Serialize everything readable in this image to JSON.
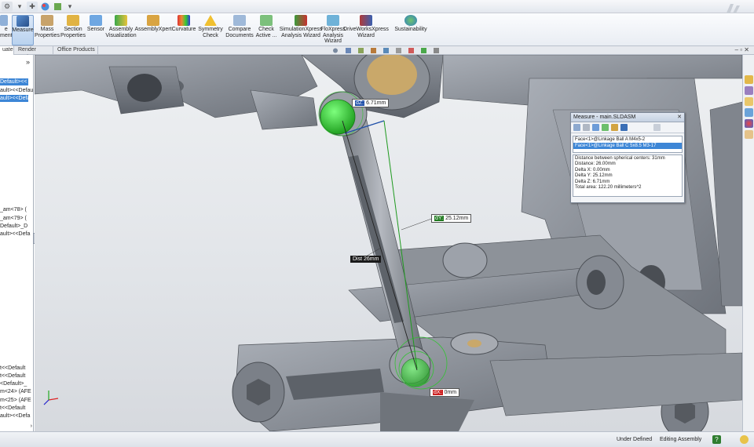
{
  "ribbon": {
    "buttons": [
      {
        "label": "Measure",
        "active": true
      },
      {
        "label": "Mass Properties"
      },
      {
        "label": "Section Properties"
      },
      {
        "label": "Sensor"
      },
      {
        "label": "Assembly Visualization"
      },
      {
        "label": "AssemblyXpert"
      },
      {
        "label": "Curvature"
      },
      {
        "label": "Symmetry Check"
      },
      {
        "label": "Compare Documents"
      },
      {
        "label": "Check Active ..."
      },
      {
        "label": "SimulationXpress Analysis Wizard"
      },
      {
        "label": "FloXpress Analysis Wizard"
      },
      {
        "label": "DriveWorksXpress Wizard"
      },
      {
        "label": "Sustainability"
      }
    ],
    "left_cut_label": "e\nment"
  },
  "tabs": [
    {
      "label": "uate",
      "active": true
    },
    {
      "label": "Render Tools"
    },
    {
      "label": "Office Products"
    }
  ],
  "tree": {
    "rows": [
      {
        "text": "Default><<",
        "selected": true
      },
      {
        "text": "ault><<Defaul"
      },
      {
        "text": "ault><<Defa",
        "selected": true
      },
      {
        "text": "_am<78> ("
      },
      {
        "text": "_am<79> ("
      },
      {
        "text": "Default>_D"
      },
      {
        "text": "ault><<Defa"
      },
      {
        "text": "t<<Default"
      },
      {
        "text": "t<<Default"
      },
      {
        "text": "<Default>_"
      },
      {
        "text": "m<24> (AFE"
      },
      {
        "text": "m<25> (AFE"
      },
      {
        "text": "t<<Default"
      },
      {
        "text": "ault><<Defa"
      }
    ],
    "expander": "»"
  },
  "viewport": {
    "dims": {
      "dz": {
        "tag": "dZ:",
        "value": "6.71mm"
      },
      "dy": {
        "tag": "dY:",
        "value": "25.12mm"
      },
      "dist": {
        "tag": "Dist",
        "value": "26mm"
      },
      "dx": {
        "tag": "dX:",
        "value": "0mm"
      }
    }
  },
  "measure_dialog": {
    "title": "Measure - main.SLDASM",
    "selections": [
      "Face<1>@Linkage Ball A M4x5-2",
      "Face<1>@Linkage Ball C 5x8.5 M3-17"
    ],
    "results": [
      "Distance between spherical centers: 31mm",
      "Distance: 26.00mm",
      "Delta X: 0.00mm",
      "Delta Y: 25.12mm",
      "Delta Z: 6.71mm",
      "Total area: 122.20 millimeters^2"
    ]
  },
  "statusbar": {
    "under_defined": "Under Defined",
    "editing": "Editing Assembly",
    "help": "?"
  },
  "colors": {
    "accent": "#3d86d6",
    "highlight_green": "#2fbf2f",
    "part_gray": "#8f949c",
    "dim_blue": "#1f4fa8",
    "dim_green": "#1f7a1f",
    "dim_red": "#cc2020"
  },
  "icons": {
    "logo": "3ds-logo-icon",
    "triad": "coordinate-triad-icon"
  }
}
